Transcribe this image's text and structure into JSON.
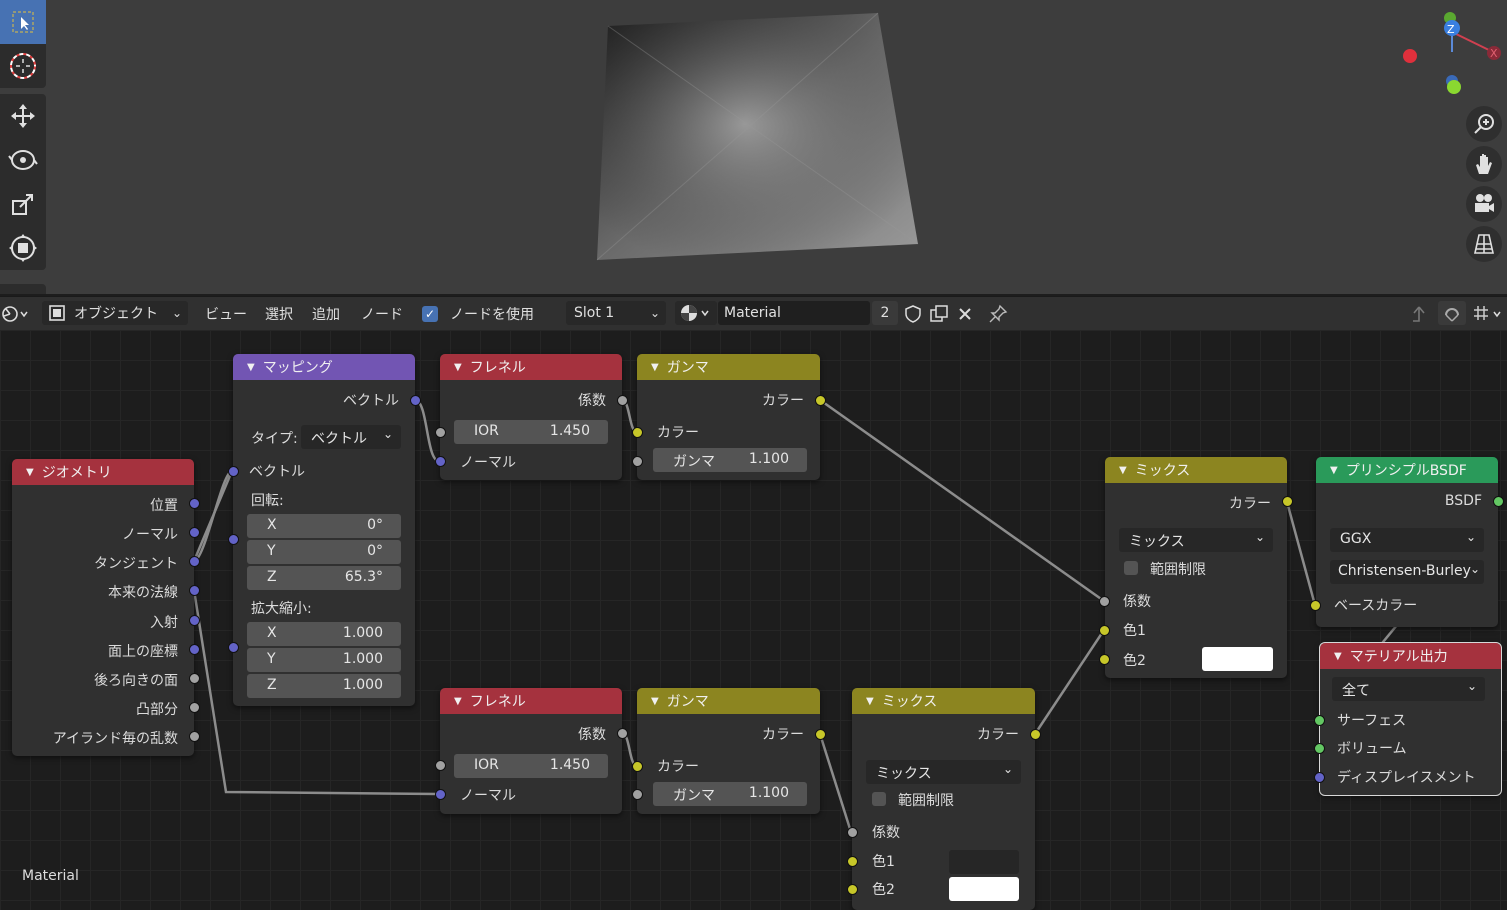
{
  "viewport": {
    "tools": [
      "select-box",
      "cursor",
      "move",
      "rotate",
      "scale",
      "transform"
    ],
    "gizmo": {
      "z": "Z",
      "x": "X"
    }
  },
  "header": {
    "mode": "オブジェクト",
    "menus": [
      "ビュー",
      "選択",
      "追加",
      "ノード"
    ],
    "use_nodes_label": "ノードを使用",
    "slot": "Slot 1",
    "material_name": "Material",
    "users": "2"
  },
  "editor": {
    "label": "Material",
    "nodes": {
      "geometry": {
        "title": "ジオメトリ",
        "outputs": [
          "位置",
          "ノーマル",
          "タンジェント",
          "本来の法線",
          "入射",
          "面上の座標",
          "後ろ向きの面",
          "凸部分",
          "アイランド毎の乱数"
        ]
      },
      "mapping": {
        "title": "マッピング",
        "out": "ベクトル",
        "type_label": "タイプ:",
        "type_value": "ベクトル",
        "in": "ベクトル",
        "rot_label": "回転:",
        "rot": [
          {
            "a": "X",
            "v": "0°"
          },
          {
            "a": "Y",
            "v": "0°"
          },
          {
            "a": "Z",
            "v": "65.3°"
          }
        ],
        "scale_label": "拡大縮小:",
        "scale": [
          {
            "a": "X",
            "v": "1.000"
          },
          {
            "a": "Y",
            "v": "1.000"
          },
          {
            "a": "Z",
            "v": "1.000"
          }
        ]
      },
      "fresnel1": {
        "title": "フレネル",
        "out": "係数",
        "ior_label": "IOR",
        "ior": "1.450",
        "in": "ノーマル"
      },
      "gamma1": {
        "title": "ガンマ",
        "out": "カラー",
        "in": "カラー",
        "gamma_label": "ガンマ",
        "gamma": "1.100"
      },
      "fresnel2": {
        "title": "フレネル",
        "out": "係数",
        "ior_label": "IOR",
        "ior": "1.450",
        "in": "ノーマル"
      },
      "gamma2": {
        "title": "ガンマ",
        "out": "カラー",
        "in": "カラー",
        "gamma_label": "ガンマ",
        "gamma": "1.100"
      },
      "mix1": {
        "title": "ミックス",
        "out": "カラー",
        "blend": "ミックス",
        "clamp": "範囲制限",
        "fac": "係数",
        "c1": "色1",
        "c2": "色2"
      },
      "mix2": {
        "title": "ミックス",
        "out": "カラー",
        "blend": "ミックス",
        "clamp": "範囲制限",
        "fac": "係数",
        "c1": "色1",
        "c2": "色2"
      },
      "bsdf": {
        "title": "プリンシプルBSDF",
        "out": "BSDF",
        "dist": "GGX",
        "sss": "Christensen-Burley",
        "base": "ベースカラー"
      },
      "output": {
        "title": "マテリアル出力",
        "target": "全て",
        "inputs": [
          "サーフェス",
          "ボリューム",
          "ディスプレイスメント"
        ]
      }
    }
  },
  "colors": {
    "accent": "#4772b3",
    "input_header": "#a5323e",
    "converter_header": "#7255b3",
    "color_header": "#8c8520",
    "shader_header": "#2a9a5a",
    "output_header": "#a5323e"
  }
}
